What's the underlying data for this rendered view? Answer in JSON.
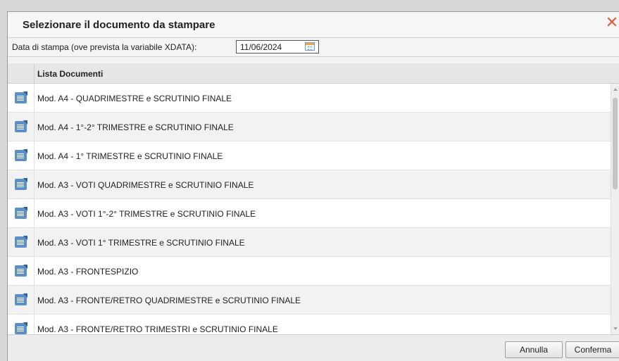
{
  "dialog": {
    "title": "Selezionare il documento da stampare",
    "close_icon": "close-icon",
    "close_glyph": "✕"
  },
  "datebar": {
    "label": "Data di stampa (ove prevista la variabile XDATA):",
    "date_value": "11/06/2024",
    "calendar_icon": "calendar-icon"
  },
  "grid": {
    "header": "Lista Documenti",
    "rows": [
      "Mod. A4 - QUADRIMESTRE e SCRUTINIO FINALE",
      "Mod. A4 - 1°-2° TRIMESTRE e SCRUTINIO FINALE",
      "Mod. A4 - 1° TRIMESTRE e SCRUTINIO FINALE",
      "Mod. A3 - VOTI QUADRIMESTRE e SCRUTINIO FINALE",
      "Mod. A3 - VOTI 1°-2° TRIMESTRE e SCRUTINIO FINALE",
      "Mod. A3 - VOTI 1° TRIMESTRE e SCRUTINIO FINALE",
      "Mod. A3 - FRONTESPIZIO",
      "Mod. A3 - FRONTE/RETRO QUADRIMESTRE e SCRUTINIO FINALE",
      "Mod. A3 - FRONTE/RETRO TRIMESTRI e SCRUTINIO FINALE"
    ],
    "row_icon": "document-icon"
  },
  "footer": {
    "cancel_label": "Annulla",
    "confirm_label": "Conferma"
  },
  "colors": {
    "close": "#e05a3c",
    "doc_icon": "#5b8fc9",
    "header_bg": "#e6e6e6"
  }
}
